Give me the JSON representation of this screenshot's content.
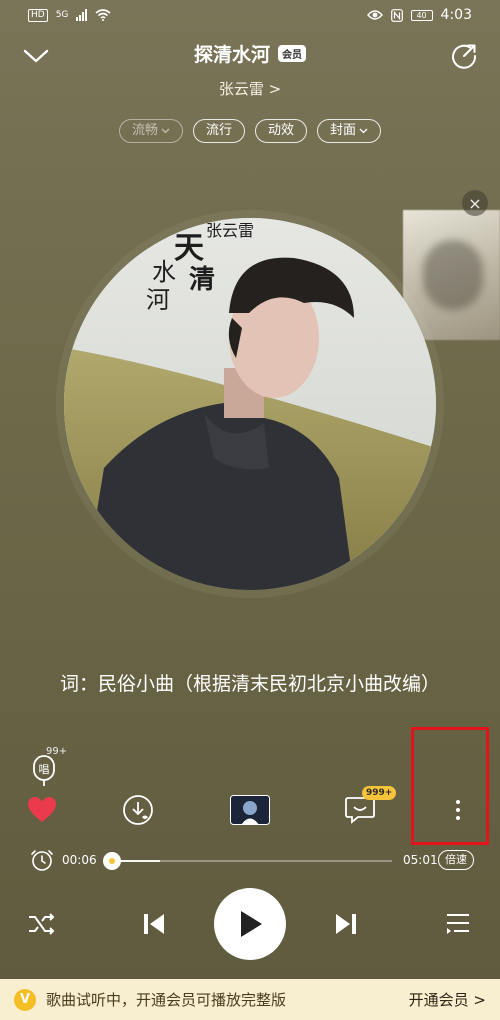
{
  "status_bar": {
    "hd_label": "HD",
    "network_label": "5G",
    "battery_label": "40",
    "time": "4:03"
  },
  "header": {
    "title": "探清水河",
    "vip_badge": "会员",
    "artist": "张云雷 >"
  },
  "chips": [
    {
      "label": "流畅",
      "has_chevron": true,
      "dim": true
    },
    {
      "label": "流行",
      "has_chevron": false,
      "dim": false
    },
    {
      "label": "动效",
      "has_chevron": false,
      "dim": false
    },
    {
      "label": "封面",
      "has_chevron": true,
      "dim": false
    }
  ],
  "album": {
    "cover_text": "张云雷 探清水河"
  },
  "lyrics": {
    "line": "词：民俗小曲（根据清末民初北京小曲改编）"
  },
  "sing": {
    "count": "99+",
    "label": "唱"
  },
  "actions": {
    "comment_count": "999+"
  },
  "progress": {
    "current": "00:06",
    "total": "05:01",
    "speed_label": "倍速",
    "fraction": 0.02
  },
  "banner": {
    "icon_label": "V",
    "text": "歌曲试听中，开通会员可播放完整版",
    "cta": "开通会员 >"
  },
  "colors": {
    "accent": "#f6c33a",
    "like": "#ea3a4c",
    "highlight": "#e3121b",
    "banner_bg": "#f8eed0"
  }
}
